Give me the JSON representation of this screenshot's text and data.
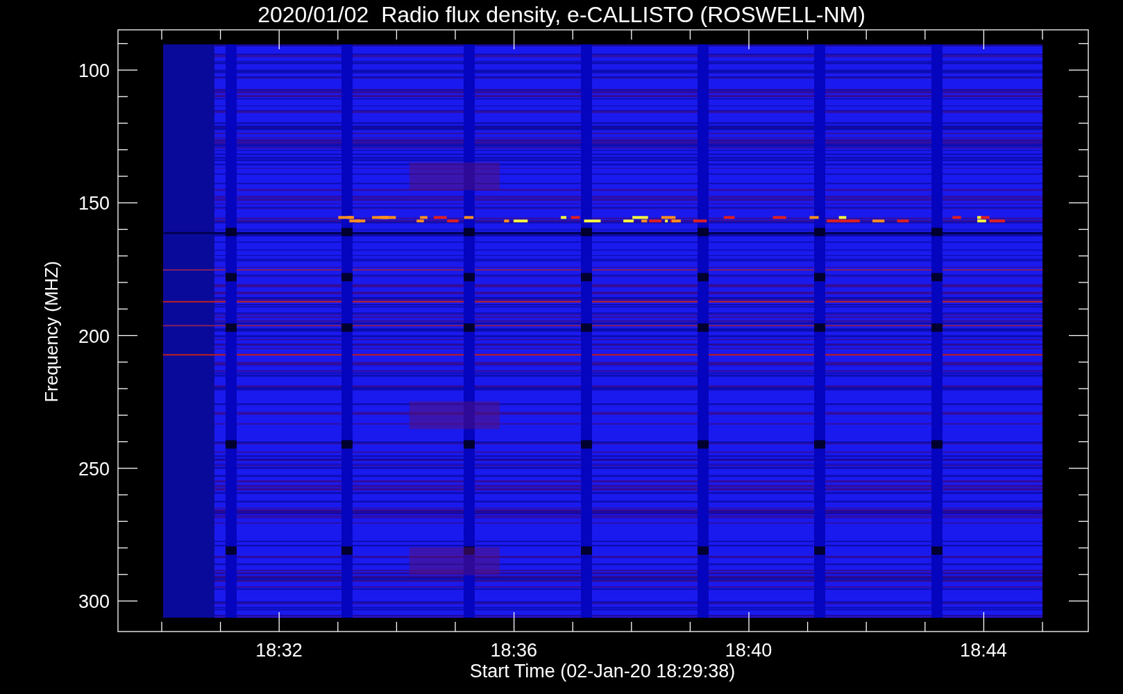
{
  "title": "2020/01/02  Radio flux density, e-CALLISTO (ROSWELL-NM)",
  "y_axis": {
    "label": "Frequency (MHZ)",
    "tick_labels": [
      "100",
      "150",
      "200",
      "250",
      "300"
    ]
  },
  "x_axis": {
    "label": "Start Time (02-Jan-20 18:29:38)",
    "tick_labels": [
      "18:32",
      "18:36",
      "18:40",
      "18:44"
    ]
  }
}
